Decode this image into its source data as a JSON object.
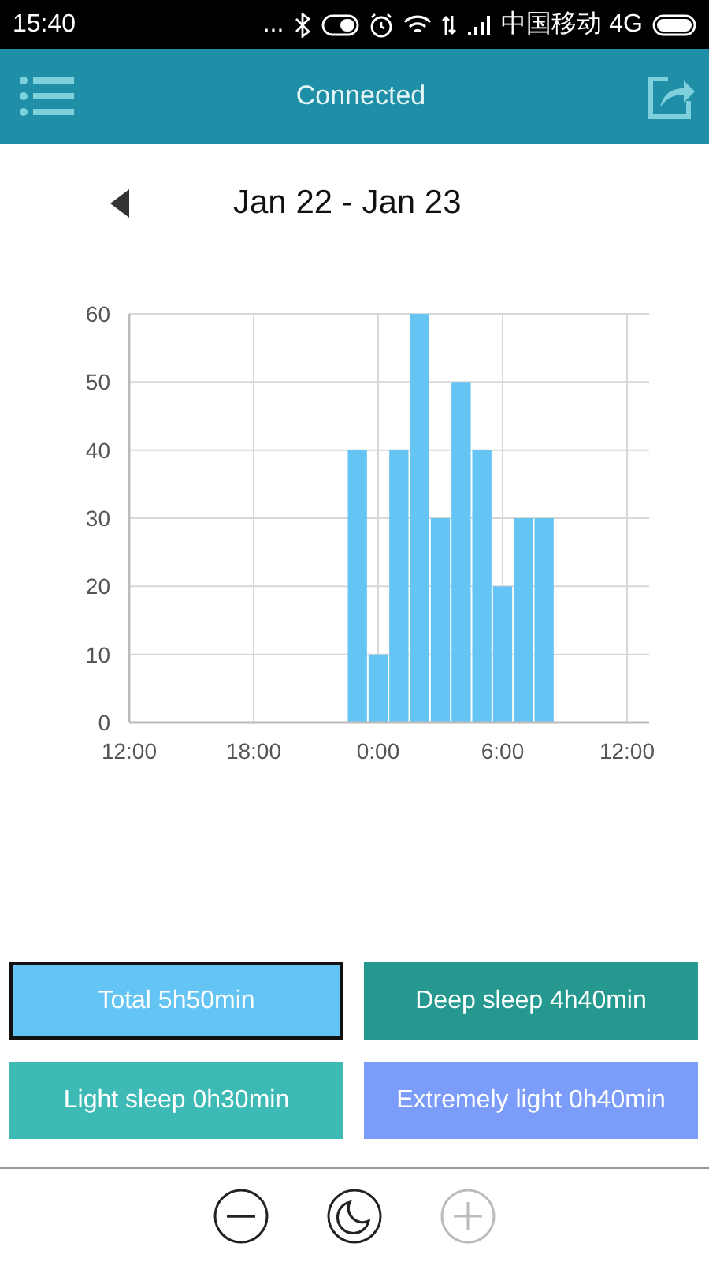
{
  "status_bar": {
    "time": "15:40",
    "more": "...",
    "carrier": "中国移动 4G"
  },
  "header": {
    "title": "Connected"
  },
  "date_nav": {
    "range": "Jan 22 - Jan 23"
  },
  "chart": {
    "chart_data": {
      "type": "bar",
      "categories": [
        "12:00",
        null,
        null,
        null,
        null,
        null,
        "18:00",
        null,
        null,
        null,
        null,
        null,
        "0:00",
        null,
        null,
        null,
        null,
        null,
        "6:00",
        null,
        null,
        null,
        null,
        null,
        "12:00"
      ],
      "series": [
        {
          "color": "#64c4f4",
          "values": [
            null,
            null,
            null,
            null,
            null,
            null,
            null,
            null,
            null,
            null,
            null,
            40,
            10,
            40,
            60,
            30,
            50,
            40,
            20,
            30,
            30,
            null,
            null,
            null,
            null
          ]
        }
      ],
      "ylim": [
        0,
        60
      ],
      "grid": true,
      "yticks": [
        0,
        10,
        20,
        30,
        40,
        50,
        60
      ]
    }
  },
  "summary": [
    {
      "label": "Total 5h50min",
      "color": "#64c4f4",
      "selected": true
    },
    {
      "label": "Deep sleep 4h40min",
      "color": "#25998f",
      "selected": false
    },
    {
      "label": "Light sleep 0h30min",
      "color": "#3dbab5",
      "selected": false
    },
    {
      "label": "Extremely light 0h40min",
      "color": "#7b9cf8",
      "selected": false
    }
  ],
  "toolbar": [
    {
      "kind": "minus",
      "disabled": false
    },
    {
      "kind": "moon",
      "disabled": false
    },
    {
      "kind": "plus",
      "disabled": true
    }
  ]
}
